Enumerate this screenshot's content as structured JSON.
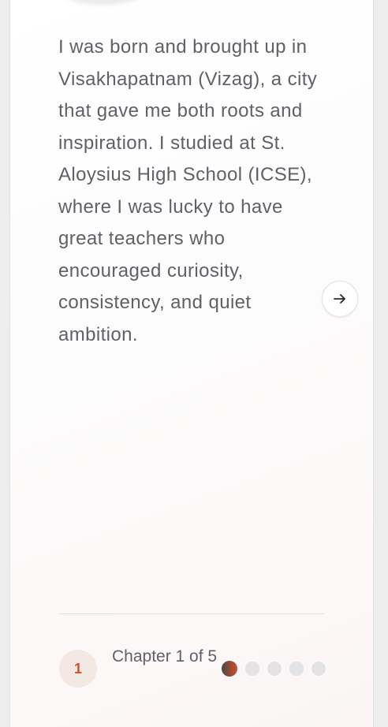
{
  "story": {
    "paragraph": "I was born and brought up in Visakhapatnam (Vizag), a city that gave me both roots and inspiration. I studied at St. Aloysius High School (ICSE), where I was lucky to have great teachers who encouraged curiosity, consistency, and quiet ambition."
  },
  "navigation": {
    "next_icon": "arrow-right-icon"
  },
  "chapter": {
    "number": "1",
    "label": "Chapter 1 of 5",
    "current": 1,
    "total": 5
  },
  "colors": {
    "accent": "#d0512a",
    "badge_bg": "#f4e8e5",
    "text": "#5f6168",
    "dot_inactive": "#e3e3e5"
  }
}
